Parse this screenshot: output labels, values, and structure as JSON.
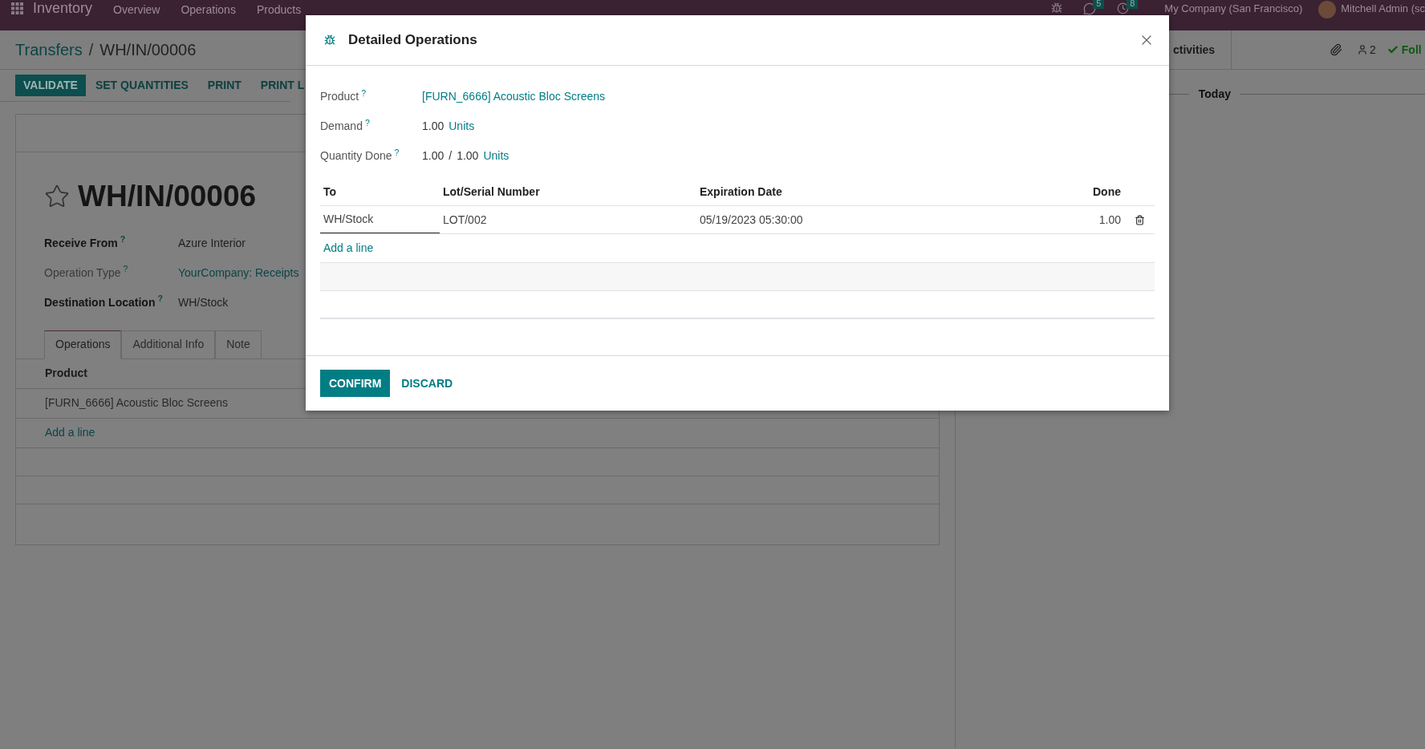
{
  "navbar": {
    "app_name": "Inventory",
    "menu": [
      "Overview",
      "Operations",
      "Products"
    ],
    "messages_count": "5",
    "activities_count": "8",
    "company": "My Company (San Francisco)",
    "user": "Mitchell Admin (sc"
  },
  "control_panel": {
    "breadcrumb": {
      "parent": "Transfers",
      "separator": "/",
      "current": "WH/IN/00006"
    },
    "buttons": [
      {
        "label": "VALIDATE",
        "kind": "primary"
      },
      {
        "label": "SET QUANTITIES",
        "kind": "secondary"
      },
      {
        "label": "PRINT",
        "kind": "secondary"
      },
      {
        "label": "PRINT L",
        "kind": "secondary"
      }
    ]
  },
  "chatter": {
    "activities": "ctivities",
    "followers_count": "2",
    "follow": "Foll",
    "separator": "Today"
  },
  "form": {
    "title": "WH/IN/00006",
    "starred": false,
    "fields": [
      {
        "label": "Receive From",
        "help": "?",
        "required": true,
        "value": "Azure Interior",
        "kind": "text"
      },
      {
        "label": "Operation Type",
        "help": "?",
        "required": false,
        "value": "YourCompany: Receipts",
        "kind": "link"
      },
      {
        "label": "Destination Location",
        "help": "?",
        "required": true,
        "value": "WH/Stock",
        "kind": "text"
      }
    ],
    "tabs": [
      {
        "label": "Operations",
        "selected": true
      },
      {
        "label": "Additional Info",
        "selected": false
      },
      {
        "label": "Note",
        "selected": false
      }
    ],
    "operations": {
      "columns": [
        "Product"
      ],
      "rows": [
        "[FURN_6666] Acoustic Bloc Screens"
      ],
      "add_line": "Add a line"
    }
  },
  "dialog": {
    "title": "Detailed Operations",
    "product": {
      "label": "Product",
      "help": "?",
      "value": "[FURN_6666] Acoustic Bloc Screens"
    },
    "demand": {
      "label": "Demand",
      "help": "?",
      "value": "1.00",
      "unit": "Units"
    },
    "quantity_done": {
      "label": "Quantity Done",
      "help": "?",
      "done": "1.00",
      "separator": "/",
      "total": "1.00",
      "unit": "Units"
    },
    "table": {
      "columns": [
        "To",
        "Lot/Serial Number",
        "Expiration Date",
        "Done"
      ],
      "rows": [
        {
          "to": "WH/Stock",
          "lot": "LOT/002",
          "expiration": "05/19/2023 05:30:00",
          "done": "1.00",
          "focused": true
        }
      ],
      "add_line": "Add a line"
    },
    "buttons": [
      {
        "label": "CONFIRM",
        "kind": "primary"
      },
      {
        "label": "DISCARD",
        "kind": "secondary"
      }
    ]
  }
}
